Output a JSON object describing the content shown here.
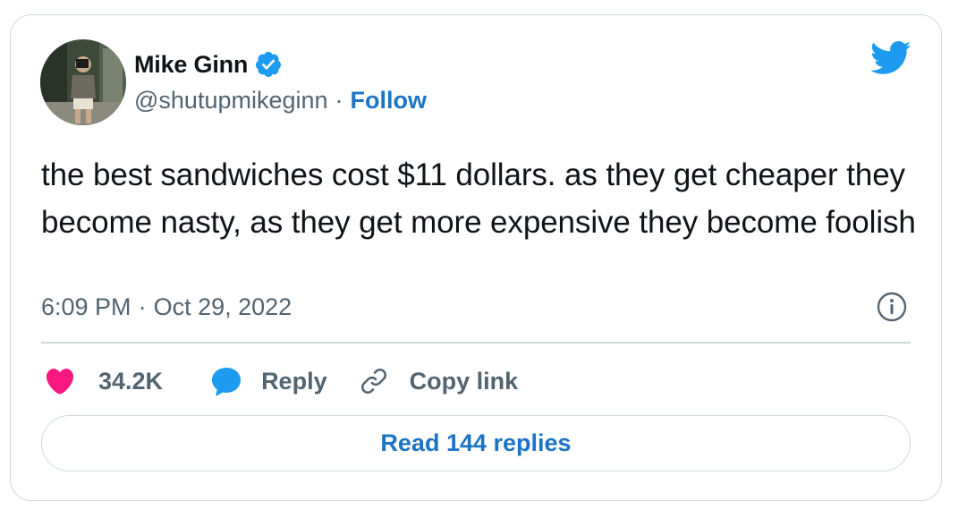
{
  "author": {
    "name": "Mike Ginn",
    "handle": "@shutupmikeginn",
    "separator": "·",
    "follow_label": "Follow",
    "verified": true
  },
  "tweet": {
    "text": "the best sandwiches cost $11 dollars. as they get cheaper they become nasty, as they get more expensive they become foolish",
    "time": "6:09 PM",
    "date_separator": "·",
    "date": "Oct 29, 2022"
  },
  "actions": {
    "like_count": "34.2K",
    "reply_label": "Reply",
    "copy_link_label": "Copy link"
  },
  "read_replies_label": "Read 144 replies",
  "icons": {
    "brand": "twitter-bird-icon",
    "verified": "verified-badge-icon",
    "info": "info-icon",
    "like": "heart-icon",
    "reply": "speech-bubble-icon",
    "copy_link": "link-icon"
  },
  "colors": {
    "brand_blue": "#1d9bf0",
    "link_blue": "#1d74c7",
    "heart": "#f91880",
    "text_primary": "#0f1419",
    "text_secondary": "#536471",
    "border": "#cfd9de"
  }
}
